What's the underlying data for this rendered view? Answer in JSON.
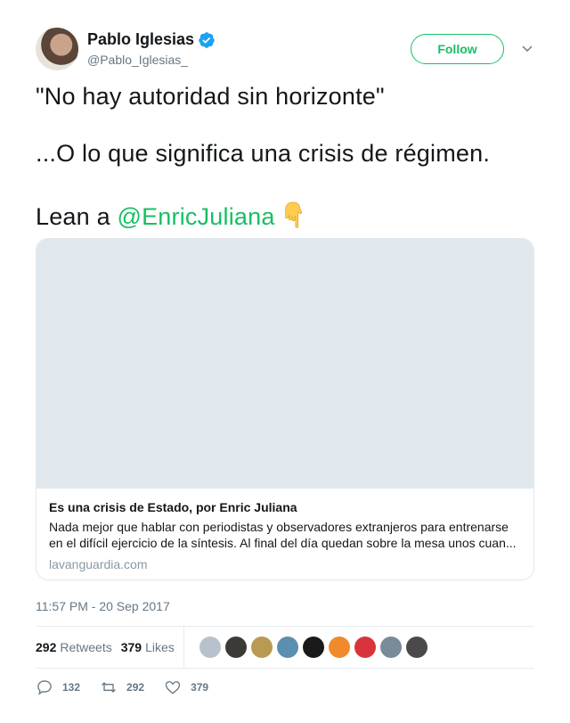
{
  "author": {
    "name": "Pablo Iglesias",
    "handle": "@Pablo_Iglesias_",
    "verified": true,
    "follow_label": "Follow"
  },
  "tweet": {
    "line1": "\"No hay autoridad sin horizonte\"",
    "line2": "...O lo que significa una crisis de régimen.",
    "line3_prefix": "Lean a ",
    "mention": "@EnricJuliana",
    "emoji": "pointing-down-emoji"
  },
  "card": {
    "title": "Es una crisis de Estado, por Enric Juliana",
    "description": "Nada mejor que hablar con periodistas y observadores extranjeros para entrenarse en el difícil ejercicio de la síntesis. Al final del día quedan sobre la mesa unos cuan...",
    "domain": "lavanguardia.com"
  },
  "timestamp": "11:57 PM - 20 Sep 2017",
  "stats": {
    "retweets_count": "292",
    "retweets_label": "Retweets",
    "likes_count": "379",
    "likes_label": "Likes"
  },
  "likers": [
    {
      "name": "liker-avatar-1",
      "color": "#b8c2cc"
    },
    {
      "name": "liker-avatar-2",
      "color": "#3b3a36"
    },
    {
      "name": "liker-avatar-3",
      "color": "#b89a52"
    },
    {
      "name": "liker-avatar-4",
      "color": "#5b8fb0"
    },
    {
      "name": "liker-avatar-5",
      "color": "#1a1a1a"
    },
    {
      "name": "liker-avatar-6",
      "color": "#f08a2c"
    },
    {
      "name": "liker-avatar-7",
      "color": "#d9343b"
    },
    {
      "name": "liker-avatar-8",
      "color": "#7a8a99"
    },
    {
      "name": "liker-avatar-9",
      "color": "#4a4a4a"
    }
  ],
  "actions": {
    "reply_count": "132",
    "retweet_count": "292",
    "like_count": "379"
  },
  "colors": {
    "accent": "#17bf63",
    "verified": "#1da1f2",
    "muted": "#657786"
  }
}
